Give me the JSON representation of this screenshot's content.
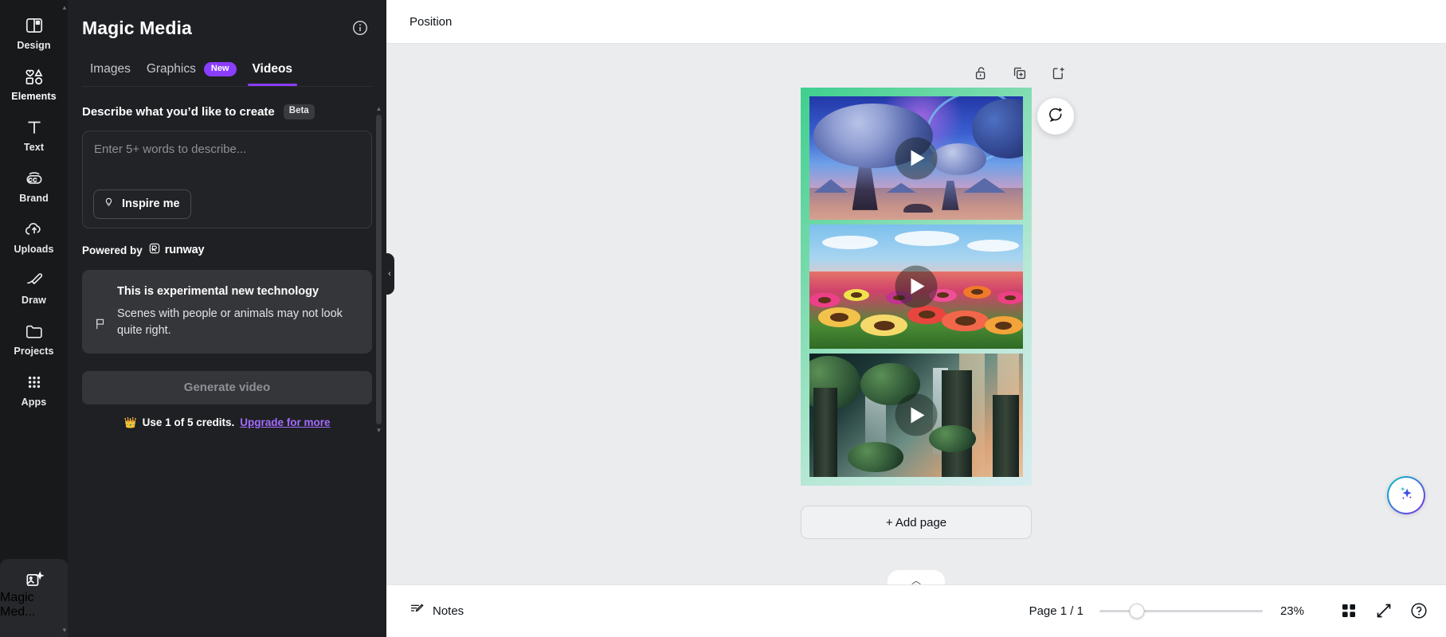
{
  "rail": {
    "items": [
      {
        "label": "Design",
        "icon": "design-icon"
      },
      {
        "label": "Elements",
        "icon": "elements-icon"
      },
      {
        "label": "Text",
        "icon": "text-icon"
      },
      {
        "label": "Brand",
        "icon": "brand-icon"
      },
      {
        "label": "Uploads",
        "icon": "uploads-icon"
      },
      {
        "label": "Draw",
        "icon": "draw-icon"
      },
      {
        "label": "Projects",
        "icon": "projects-icon"
      },
      {
        "label": "Apps",
        "icon": "apps-icon"
      }
    ],
    "active_bottom": {
      "label": "Magic Med...",
      "icon": "magic-media-icon"
    }
  },
  "panel": {
    "title": "Magic Media",
    "info_icon": "info-icon",
    "tabs": [
      {
        "label": "Images",
        "badge": ""
      },
      {
        "label": "Graphics",
        "badge": "New"
      },
      {
        "label": "Videos",
        "badge": ""
      }
    ],
    "active_tab": "Videos",
    "section_label": "Describe what you’d like to create",
    "section_badge": "Beta",
    "prompt_placeholder": "Enter 5+ words to describe...",
    "prompt_value": "",
    "inspire_label": "Inspire me",
    "inspire_icon": "lightbulb-icon",
    "powered_by_label": "Powered by",
    "powered_by_brand": "runway",
    "note": {
      "icon": "flag-icon",
      "title": "This is experimental new technology",
      "body": "Scenes with people or animals may not look quite right."
    },
    "generate_label": "Generate video",
    "credits_icon": "crown-icon",
    "credits_text": "Use 1 of 5 credits.",
    "credits_link": "Upgrade for more",
    "collapse_icon": "chevron-left-icon",
    "accent_color": "#8b3dff",
    "link_color": "#a26bff"
  },
  "toolbar": {
    "position_label": "Position"
  },
  "canvas": {
    "page_tools": [
      {
        "name": "unlock-icon",
        "label": "Unlock"
      },
      {
        "name": "duplicate-page-icon",
        "label": "Duplicate page"
      },
      {
        "name": "add-page-icon",
        "label": "Add page"
      }
    ],
    "comment_icon": "add-comment-icon",
    "add_page_label": "+ Add page",
    "collapse_bar_icon": "chevron-up-icon",
    "magic_fab_icon": "sparkles-icon",
    "page_background": "#3ecf8e",
    "videos": [
      {
        "alt": "Alien landscape with mushroom rock formations",
        "play_icon": "play-icon"
      },
      {
        "alt": "Colorful flower field under blue sky",
        "play_icon": "play-icon"
      },
      {
        "alt": "Green futuristic forest city at sunrise",
        "play_icon": "play-icon"
      }
    ]
  },
  "bottombar": {
    "notes_label": "Notes",
    "notes_icon": "notes-icon",
    "page_count": "Page 1 / 1",
    "zoom_value": "23%",
    "zoom_percent": 23,
    "grid_icon": "grid-view-icon",
    "fullscreen_icon": "fullscreen-icon",
    "help_icon": "help-icon"
  }
}
